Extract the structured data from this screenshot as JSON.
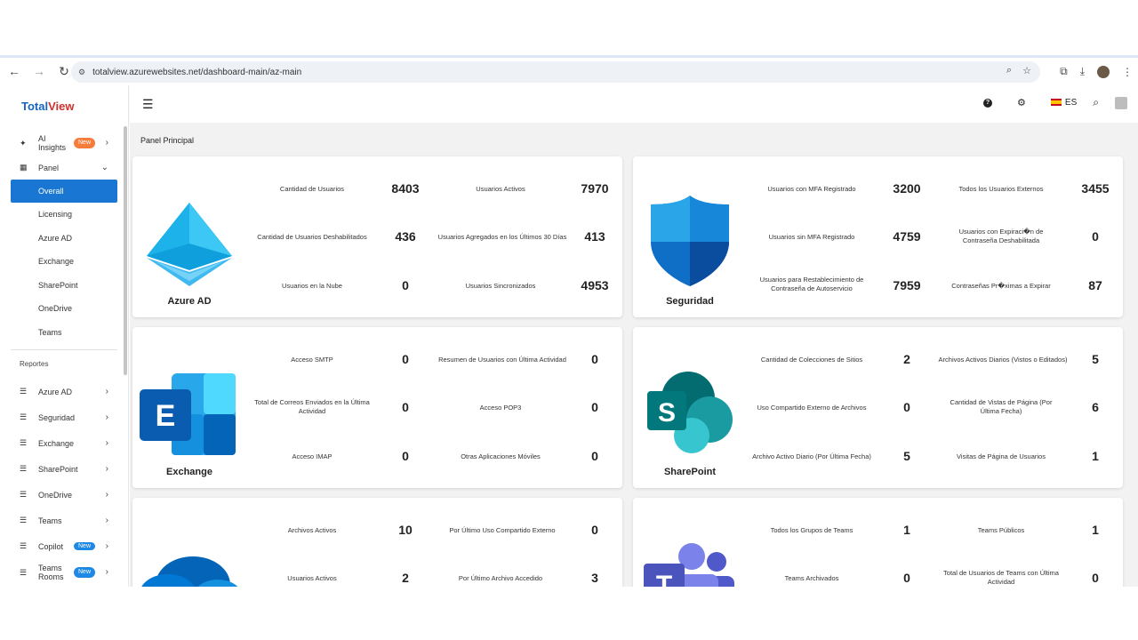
{
  "browser": {
    "url": "totalview.azurewebsites.net/dashboard-main/az-main"
  },
  "app": {
    "logo_part1": "Total",
    "logo_part2": "View",
    "language": "ES"
  },
  "sidebar": {
    "ai_insights": "AI Insights",
    "new_badge": "New",
    "panel": "Panel",
    "panel_items": [
      "Overall",
      "Licensing",
      "Azure AD",
      "Exchange",
      "SharePoint",
      "OneDrive",
      "Teams"
    ],
    "reports_section": "Reportes",
    "reports": [
      "Azure AD",
      "Seguridad",
      "Exchange",
      "SharePoint",
      "OneDrive",
      "Teams"
    ],
    "copilot": "Copilot",
    "teams_rooms": "Teams Rooms"
  },
  "page": {
    "title": "Panel Principal"
  },
  "cards": {
    "azure": {
      "name": "Azure AD",
      "metrics": [
        {
          "label": "Cantidad de Usuarios",
          "value": "8403"
        },
        {
          "label": "Usuarios Activos",
          "value": "7970"
        },
        {
          "label": "Cantidad de Usuarios Deshabilitados",
          "value": "436"
        },
        {
          "label": "Usuarios Agregados en los Últimos 30 Días",
          "value": "413"
        },
        {
          "label": "Usuarios en la Nube",
          "value": "0"
        },
        {
          "label": "Usuarios Sincronizados",
          "value": "4953"
        }
      ]
    },
    "seguridad": {
      "name": "Seguridad",
      "metrics": [
        {
          "label": "Usuarios con MFA Registrado",
          "value": "3200"
        },
        {
          "label": "Todos los Usuarios Externos",
          "value": "3455"
        },
        {
          "label": "Usuarios sin MFA Registrado",
          "value": "4759"
        },
        {
          "label": "Usuarios con Expiraci�n de Contraseña Deshabilitada",
          "value": "0"
        },
        {
          "label": "Usuarios para Restablecimiento de Contraseña de Autoservicio",
          "value": "7959"
        },
        {
          "label": "Contraseñas Pr�ximas a Expirar",
          "value": "87"
        }
      ]
    },
    "exchange": {
      "name": "Exchange",
      "metrics": [
        {
          "label": "Acceso SMTP",
          "value": "0"
        },
        {
          "label": "Resumen de Usuarios con Última Actividad",
          "value": "0"
        },
        {
          "label": "Total de Correos Enviados en la Última Actividad",
          "value": "0"
        },
        {
          "label": "Acceso POP3",
          "value": "0"
        },
        {
          "label": "Acceso IMAP",
          "value": "0"
        },
        {
          "label": "Otras Aplicaciones Móviles",
          "value": "0"
        }
      ]
    },
    "sharepoint": {
      "name": "SharePoint",
      "metrics": [
        {
          "label": "Cantidad de Colecciones de Sitios",
          "value": "2"
        },
        {
          "label": "Archivos Activos Diarios (Vistos o Editados)",
          "value": "5"
        },
        {
          "label": "Uso Compartido Externo de Archivos",
          "value": "0"
        },
        {
          "label": "Cantidad de Vistas de Página (Por Última Fecha)",
          "value": "6"
        },
        {
          "label": "Archivo Activo Diario (Por Última Fecha)",
          "value": "5"
        },
        {
          "label": "Visitas de Página de Usuarios",
          "value": "1"
        }
      ]
    },
    "onedrive": {
      "metrics": [
        {
          "label": "Archivos Activos",
          "value": "10"
        },
        {
          "label": "Por Último Uso Compartido Externo",
          "value": "0"
        },
        {
          "label": "Usuarios Activos",
          "value": "2"
        },
        {
          "label": "Por Último Archivo Accedido",
          "value": "3"
        }
      ]
    },
    "teams": {
      "metrics": [
        {
          "label": "Todos los Grupos de Teams",
          "value": "1"
        },
        {
          "label": "Teams Públicos",
          "value": "1"
        },
        {
          "label": "Teams Archivados",
          "value": "0"
        },
        {
          "label": "Total de Usuarios de Teams con Última Actividad",
          "value": "0"
        }
      ]
    }
  }
}
